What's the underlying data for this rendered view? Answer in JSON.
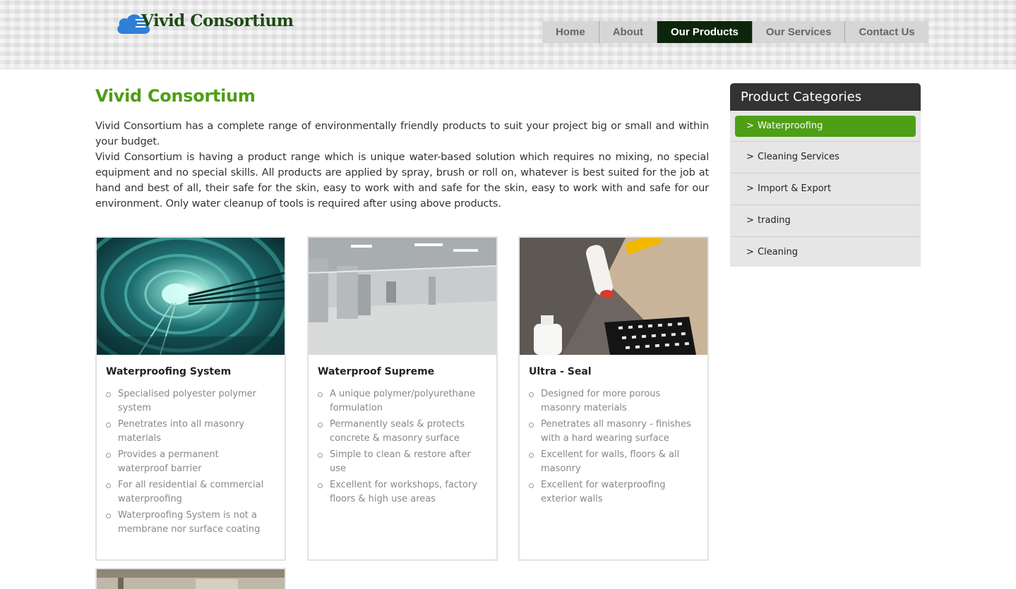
{
  "header": {
    "logo_text": "Vivid Consortium",
    "nav": [
      {
        "label": "Home",
        "active": false
      },
      {
        "label": "About",
        "active": false
      },
      {
        "label": "Our Products",
        "active": true
      },
      {
        "label": "Our Services",
        "active": false
      },
      {
        "label": "Contact Us",
        "active": false
      }
    ]
  },
  "main": {
    "title": "Vivid Consortium",
    "intro": [
      "Vivid Consortium has a complete range of environmentally friendly products to suit your project big or small and within your budget.",
      "Vivid Consortium is having a product range which is unique water-based solution which requires no mixing, no special equipment and no special skills. All products are applied by spray, brush or roll on, whatever is best suited for the job at hand and best of all, their safe for the skin, easy to work with and safe for the skin, easy to work with and safe for our environment. Only water cleanup of tools is required after using above products."
    ],
    "products": [
      {
        "title": "Waterproofing System",
        "image": "tunnel-photo",
        "bullets": [
          "Specialised polyester polymer system",
          "Penetrates into all masonry materials",
          "Provides a permanent waterproof barrier",
          "For all residential & commercial waterproofing",
          "Waterproofing System is not a membrane nor surface coating"
        ]
      },
      {
        "title": "Waterproof Supreme",
        "image": "parking-garage-photo",
        "bullets": [
          "A unique polymer/polyurethane formulation",
          "Permanently seals & protects concrete & masonry surface",
          "Simple to clean & restore after use",
          "Excellent for workshops, factory floors & high use areas"
        ]
      },
      {
        "title": "Ultra - Seal",
        "image": "paint-roller-photo",
        "bullets": [
          "Designed for more porous masonry materials",
          "Penetrates all masonry - finishes with a hard wearing surface",
          "Excellent for walls, floors & all masonry",
          "Excellent for waterproofing exterior walls"
        ]
      }
    ]
  },
  "sidebar": {
    "title": "Product Categories",
    "arrow": ">",
    "categories": [
      {
        "label": "Waterproofing",
        "active": true
      },
      {
        "label": "Cleaning Services",
        "active": false
      },
      {
        "label": "Import & Export",
        "active": false
      },
      {
        "label": "trading",
        "active": false
      },
      {
        "label": "Cleaning",
        "active": false
      }
    ]
  },
  "colors": {
    "accent_green": "#4e9e16",
    "nav_active": "#0d260b",
    "sidebar_header": "#333333"
  }
}
